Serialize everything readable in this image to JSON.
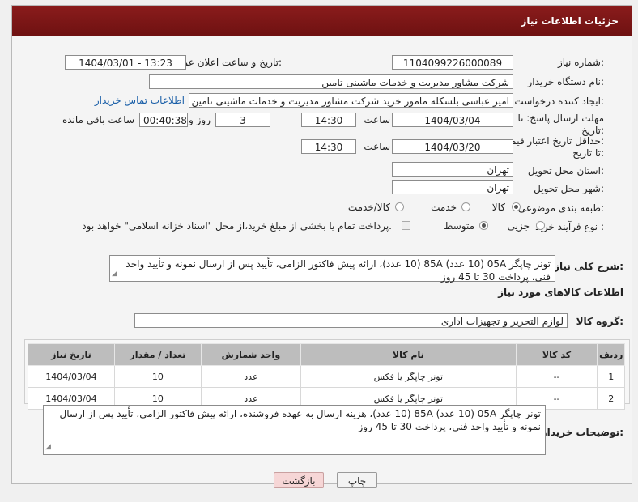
{
  "header": {
    "title": "جزئیات اطلاعات نیاز"
  },
  "form": {
    "need_number_label": "شماره نیاز:",
    "need_number": "1104099226000089",
    "announce_label": "تاریخ و ساعت اعلان عمومی:",
    "announce_value": "1404/03/01 - 13:23",
    "buyer_org_label": "نام دستگاه خریدار:",
    "buyer_org": "شرکت مشاور مدیریت و خدمات ماشینی تامین",
    "creator_label": "ایجاد کننده درخواست:",
    "creator": "امیر عباسی بلسکله مامور خرید شرکت مشاور مدیریت و خدمات ماشینی تامین",
    "contact_link": "اطلاعات تماس خریدار",
    "reply_deadline_label_1": "مهلت ارسال پاسخ: تا",
    "reply_deadline_label_2": "تاریخ:",
    "reply_date": "1404/03/04",
    "time_label": "ساعت",
    "reply_time": "14:30",
    "days_value": "3",
    "days_label": "روز و",
    "remaining_time": "00:40:38",
    "remaining_label": "ساعت باقی مانده",
    "price_validity_label_1": "حداقل تاریخ اعتبار قیمت:",
    "price_validity_label_2": "تا تاریخ:",
    "price_date": "1404/03/20",
    "price_time": "14:30",
    "province_label": "استان محل تحویل:",
    "province": "تهران",
    "city_label": "شهر محل تحویل:",
    "city": "تهران",
    "category_label": "طبقه بندی موضوعی:",
    "category_options": [
      "کالا",
      "خدمت",
      "کالا/خدمت"
    ],
    "process_label": "نوع فرآیند خرید :",
    "process_options": [
      "جزیی",
      "متوسط"
    ],
    "payment_note": "پرداخت تمام یا بخشی از مبلغ خرید،از محل \"اسناد خزانه اسلامی\" خواهد بود.",
    "description_label": "شرح کلی نیاز:",
    "description": "تونر چاپگر 05A (10 عدد) 85A (10 عدد)، ارائه پیش فاکتور الزامی، تأیید پس از ارسال نمونه و تأیید واحد فنی، پرداخت 30 تا 45 روز",
    "goods_info_title": "اطلاعات کالاهای مورد نیاز",
    "goods_group_label": "گروه کالا:",
    "goods_group": "لوازم التحریر و تجهیزات اداری",
    "buyer_notes_label": "توضیحات خریدار:",
    "buyer_notes": "تونر چاپگر 05A (10 عدد) 85A (10 عدد)، هزینه ارسال به عهده فروشنده، ارائه پیش فاکتور الزامی، تأیید پس از ارسال نمونه و تأیید واحد فنی، پرداخت 30 تا 45 روز"
  },
  "table": {
    "headers": [
      "ردیف",
      "کد کالا",
      "نام کالا",
      "واحد شمارش",
      "تعداد / مقدار",
      "تاریخ نیاز"
    ],
    "rows": [
      [
        "1",
        "--",
        "تونر چاپگر یا فکس",
        "عدد",
        "10",
        "1404/03/04"
      ],
      [
        "2",
        "--",
        "تونر چاپگر یا فکس",
        "عدد",
        "10",
        "1404/03/04"
      ]
    ]
  },
  "buttons": {
    "print": "چاپ",
    "back": "بازگشت"
  },
  "colors": {
    "header_bg": "#7a1616",
    "link": "#1a5fa8",
    "back_button_bg": "#f6d6d6"
  }
}
